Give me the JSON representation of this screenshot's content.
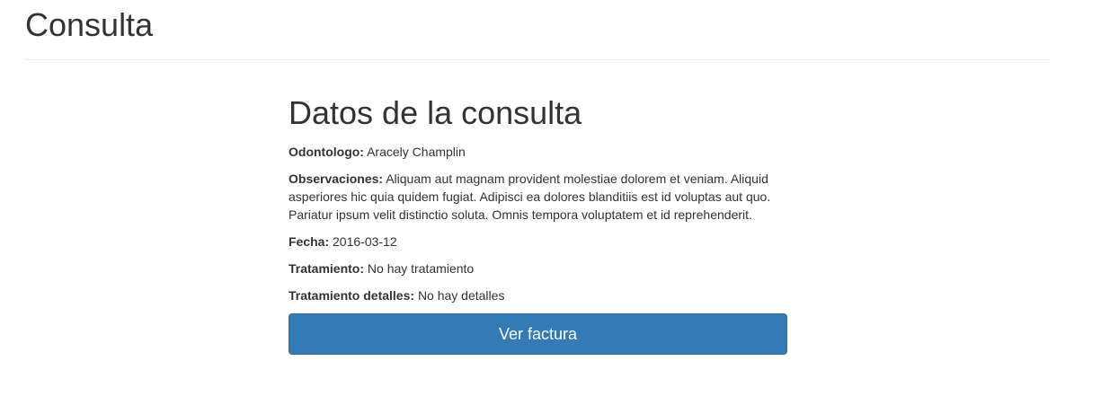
{
  "header": {
    "title": "Consulta"
  },
  "consulta": {
    "section_title": "Datos de la consulta",
    "fields": [
      {
        "label": "Odontologo:",
        "value": "Aracely Champlin"
      },
      {
        "label": "Observaciones:",
        "value": "Aliquam aut magnam provident molestiae dolorem et veniam. Aliquid asperiores hic quia quidem fugiat. Adipisci ea dolores blanditiis est id voluptas aut quo. Pariatur ipsum velit distinctio soluta. Omnis tempora voluptatem et id reprehenderit."
      },
      {
        "label": "Fecha:",
        "value": "2016-03-12"
      },
      {
        "label": "Tratamiento:",
        "value": "No hay tratamiento"
      },
      {
        "label": "Tratamiento detalles:",
        "value": "No hay detalles"
      }
    ],
    "button_label": "Ver factura"
  },
  "colors": {
    "primary": "#337ab7",
    "primary_border": "#2e6da4",
    "text": "#333333",
    "divider": "#eeeeee"
  }
}
